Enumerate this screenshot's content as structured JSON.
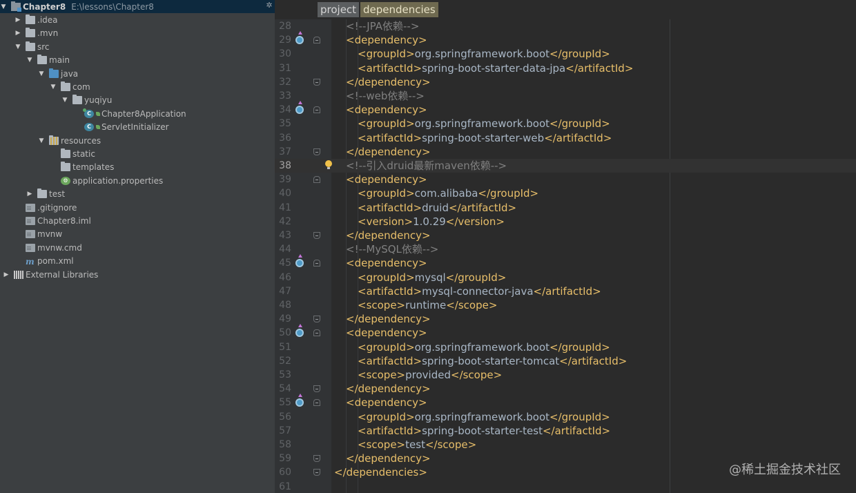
{
  "project_tree": {
    "root": {
      "name": "Chapter8",
      "path": "E:\\lessons\\Chapter8"
    },
    "items": [
      {
        "label": ".idea",
        "depth": 1,
        "arrow": "▶",
        "icon": "folder-icon"
      },
      {
        "label": ".mvn",
        "depth": 1,
        "arrow": "▶",
        "icon": "folder-icon"
      },
      {
        "label": "src",
        "depth": 1,
        "arrow": "▼",
        "icon": "folder-icon"
      },
      {
        "label": "main",
        "depth": 2,
        "arrow": "▼",
        "icon": "folder-icon"
      },
      {
        "label": "java",
        "depth": 3,
        "arrow": "▼",
        "icon": "source-folder-icon"
      },
      {
        "label": "com",
        "depth": 4,
        "arrow": "▼",
        "icon": "package-icon"
      },
      {
        "label": "yuqiyu",
        "depth": 5,
        "arrow": "▼",
        "icon": "package-icon"
      },
      {
        "label": "Chapter8Application",
        "depth": 6,
        "arrow": "",
        "icon": "spring-boot-class-icon"
      },
      {
        "label": "ServletInitializer",
        "depth": 6,
        "arrow": "",
        "icon": "class-icon"
      },
      {
        "label": "resources",
        "depth": 3,
        "arrow": "▼",
        "icon": "resources-folder-icon"
      },
      {
        "label": "static",
        "depth": 4,
        "arrow": "",
        "icon": "folder-icon"
      },
      {
        "label": "templates",
        "depth": 4,
        "arrow": "",
        "icon": "folder-icon"
      },
      {
        "label": "application.properties",
        "depth": 4,
        "arrow": "",
        "icon": "properties-file-icon"
      },
      {
        "label": "test",
        "depth": 2,
        "arrow": "▶",
        "icon": "folder-icon"
      },
      {
        "label": ".gitignore",
        "depth": 1,
        "arrow": "",
        "icon": "text-file-icon"
      },
      {
        "label": "Chapter8.iml",
        "depth": 1,
        "arrow": "",
        "icon": "iml-file-icon"
      },
      {
        "label": "mvnw",
        "depth": 1,
        "arrow": "",
        "icon": "text-file-icon"
      },
      {
        "label": "mvnw.cmd",
        "depth": 1,
        "arrow": "",
        "icon": "text-file-icon"
      },
      {
        "label": "pom.xml",
        "depth": 1,
        "arrow": "",
        "icon": "maven-icon"
      },
      {
        "label": "External Libraries",
        "depth": 0,
        "arrow": "▶",
        "icon": "libraries-icon"
      }
    ]
  },
  "breadcrumbs": [
    "project",
    "dependencies"
  ],
  "editor": {
    "current_line": 38,
    "lines": [
      {
        "n": "28",
        "indent": 1,
        "gutter": "",
        "fold": "",
        "parts": [
          [
            "cmt",
            "<!--JPA依赖-->"
          ]
        ]
      },
      {
        "n": "29",
        "indent": 1,
        "gutter": "override",
        "fold": "start",
        "parts": [
          [
            "tag",
            "<dependency>"
          ]
        ]
      },
      {
        "n": "30",
        "indent": 2,
        "gutter": "",
        "fold": "",
        "parts": [
          [
            "tag",
            "<groupId>"
          ],
          [
            "txt",
            "org.springframework.boot"
          ],
          [
            "tag",
            "</groupId>"
          ]
        ]
      },
      {
        "n": "31",
        "indent": 2,
        "gutter": "",
        "fold": "",
        "parts": [
          [
            "tag",
            "<artifactId>"
          ],
          [
            "txt",
            "spring-boot-starter-data-jpa"
          ],
          [
            "tag",
            "</artifactId>"
          ]
        ]
      },
      {
        "n": "32",
        "indent": 1,
        "gutter": "",
        "fold": "end",
        "parts": [
          [
            "tag",
            "</dependency>"
          ]
        ]
      },
      {
        "n": "33",
        "indent": 1,
        "gutter": "",
        "fold": "",
        "parts": [
          [
            "cmt",
            "<!--web依赖-->"
          ]
        ]
      },
      {
        "n": "34",
        "indent": 1,
        "gutter": "override",
        "fold": "start",
        "parts": [
          [
            "tag",
            "<dependency>"
          ]
        ]
      },
      {
        "n": "35",
        "indent": 2,
        "gutter": "",
        "fold": "",
        "parts": [
          [
            "tag",
            "<groupId>"
          ],
          [
            "txt",
            "org.springframework.boot"
          ],
          [
            "tag",
            "</groupId>"
          ]
        ]
      },
      {
        "n": "36",
        "indent": 2,
        "gutter": "",
        "fold": "",
        "parts": [
          [
            "tag",
            "<artifactId>"
          ],
          [
            "txt",
            "spring-boot-starter-web"
          ],
          [
            "tag",
            "</artifactId>"
          ]
        ]
      },
      {
        "n": "37",
        "indent": 1,
        "gutter": "",
        "fold": "end",
        "parts": [
          [
            "tag",
            "</dependency>"
          ]
        ]
      },
      {
        "n": "38",
        "indent": 1,
        "gutter": "bulb",
        "fold": "",
        "parts": [
          [
            "cmt",
            "<!--引入druid最新maven依赖-->"
          ]
        ]
      },
      {
        "n": "39",
        "indent": 1,
        "gutter": "",
        "fold": "start",
        "parts": [
          [
            "tag",
            "<dependency>"
          ]
        ]
      },
      {
        "n": "40",
        "indent": 2,
        "gutter": "",
        "fold": "",
        "parts": [
          [
            "tag",
            "<groupId>"
          ],
          [
            "txt",
            "com.alibaba"
          ],
          [
            "tag",
            "</groupId>"
          ]
        ]
      },
      {
        "n": "41",
        "indent": 2,
        "gutter": "",
        "fold": "",
        "parts": [
          [
            "tag",
            "<artifactId>"
          ],
          [
            "txt",
            "druid"
          ],
          [
            "tag",
            "</artifactId>"
          ]
        ]
      },
      {
        "n": "42",
        "indent": 2,
        "gutter": "",
        "fold": "",
        "parts": [
          [
            "tag",
            "<version>"
          ],
          [
            "txt",
            "1.0.29"
          ],
          [
            "tag",
            "</version>"
          ]
        ]
      },
      {
        "n": "43",
        "indent": 1,
        "gutter": "",
        "fold": "end",
        "parts": [
          [
            "tag",
            "</dependency>"
          ]
        ]
      },
      {
        "n": "44",
        "indent": 1,
        "gutter": "",
        "fold": "",
        "parts": [
          [
            "cmt",
            "<!--MySQL依赖-->"
          ]
        ]
      },
      {
        "n": "45",
        "indent": 1,
        "gutter": "override",
        "fold": "start",
        "parts": [
          [
            "tag",
            "<dependency>"
          ]
        ]
      },
      {
        "n": "46",
        "indent": 2,
        "gutter": "",
        "fold": "",
        "parts": [
          [
            "tag",
            "<groupId>"
          ],
          [
            "txt",
            "mysql"
          ],
          [
            "tag",
            "</groupId>"
          ]
        ]
      },
      {
        "n": "47",
        "indent": 2,
        "gutter": "",
        "fold": "",
        "parts": [
          [
            "tag",
            "<artifactId>"
          ],
          [
            "txt",
            "mysql-connector-java"
          ],
          [
            "tag",
            "</artifactId>"
          ]
        ]
      },
      {
        "n": "48",
        "indent": 2,
        "gutter": "",
        "fold": "",
        "parts": [
          [
            "tag",
            "<scope>"
          ],
          [
            "txt",
            "runtime"
          ],
          [
            "tag",
            "</scope>"
          ]
        ]
      },
      {
        "n": "49",
        "indent": 1,
        "gutter": "",
        "fold": "end",
        "parts": [
          [
            "tag",
            "</dependency>"
          ]
        ]
      },
      {
        "n": "50",
        "indent": 1,
        "gutter": "override",
        "fold": "start",
        "parts": [
          [
            "tag",
            "<dependency>"
          ]
        ]
      },
      {
        "n": "51",
        "indent": 2,
        "gutter": "",
        "fold": "",
        "parts": [
          [
            "tag",
            "<groupId>"
          ],
          [
            "txt",
            "org.springframework.boot"
          ],
          [
            "tag",
            "</groupId>"
          ]
        ]
      },
      {
        "n": "52",
        "indent": 2,
        "gutter": "",
        "fold": "",
        "parts": [
          [
            "tag",
            "<artifactId>"
          ],
          [
            "txt",
            "spring-boot-starter-tomcat"
          ],
          [
            "tag",
            "</artifactId>"
          ]
        ]
      },
      {
        "n": "53",
        "indent": 2,
        "gutter": "",
        "fold": "",
        "parts": [
          [
            "tag",
            "<scope>"
          ],
          [
            "txt",
            "provided"
          ],
          [
            "tag",
            "</scope>"
          ]
        ]
      },
      {
        "n": "54",
        "indent": 1,
        "gutter": "",
        "fold": "end",
        "parts": [
          [
            "tag",
            "</dependency>"
          ]
        ]
      },
      {
        "n": "55",
        "indent": 1,
        "gutter": "override",
        "fold": "start",
        "parts": [
          [
            "tag",
            "<dependency>"
          ]
        ]
      },
      {
        "n": "56",
        "indent": 2,
        "gutter": "",
        "fold": "",
        "parts": [
          [
            "tag",
            "<groupId>"
          ],
          [
            "txt",
            "org.springframework.boot"
          ],
          [
            "tag",
            "</groupId>"
          ]
        ]
      },
      {
        "n": "57",
        "indent": 2,
        "gutter": "",
        "fold": "",
        "parts": [
          [
            "tag",
            "<artifactId>"
          ],
          [
            "txt",
            "spring-boot-starter-test"
          ],
          [
            "tag",
            "</artifactId>"
          ]
        ]
      },
      {
        "n": "58",
        "indent": 2,
        "gutter": "",
        "fold": "",
        "parts": [
          [
            "tag",
            "<scope>"
          ],
          [
            "txt",
            "test"
          ],
          [
            "tag",
            "</scope>"
          ]
        ]
      },
      {
        "n": "59",
        "indent": 1,
        "gutter": "",
        "fold": "end",
        "parts": [
          [
            "tag",
            "</dependency>"
          ]
        ]
      },
      {
        "n": "60",
        "indent": 0,
        "gutter": "",
        "fold": "end",
        "parts": [
          [
            "tag",
            "</dependencies>"
          ]
        ]
      },
      {
        "n": "61",
        "indent": 0,
        "gutter": "",
        "fold": "",
        "parts": []
      }
    ]
  },
  "watermark": "@稀土掘金技术社区",
  "colors": {
    "tag": "#e8bf6a",
    "text": "#a9b7c6",
    "comment": "#808080",
    "tree_bg": "#3c3f41",
    "editor_bg": "#2b2b2b"
  }
}
